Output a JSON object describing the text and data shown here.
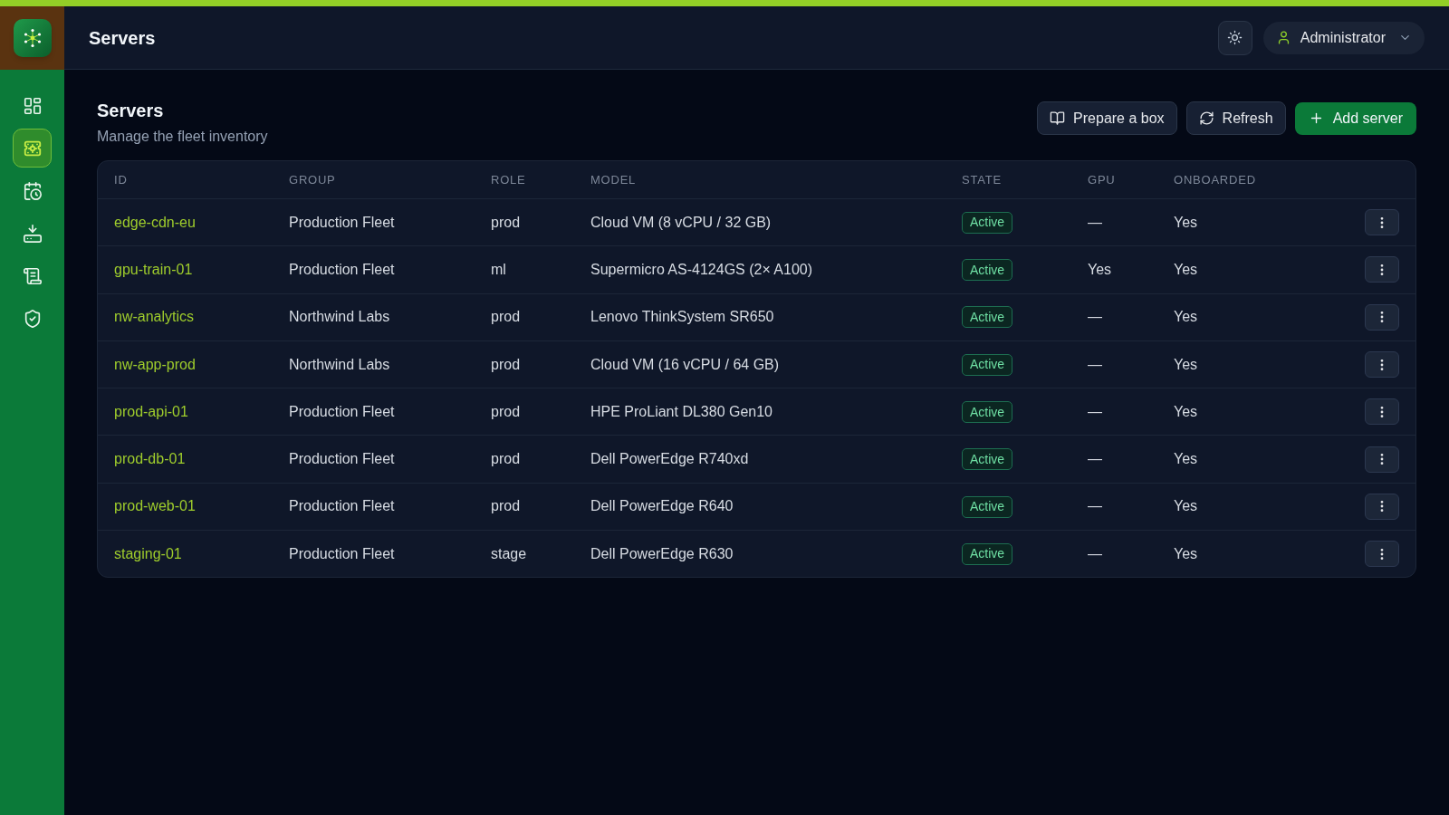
{
  "sidebar": {
    "items": [
      {
        "selected": false
      },
      {
        "selected": true
      },
      {
        "selected": false
      },
      {
        "selected": false
      },
      {
        "selected": false
      },
      {
        "selected": false
      }
    ]
  },
  "header": {
    "title": "Servers",
    "user": {
      "name": "Administrator"
    }
  },
  "page": {
    "title": "Servers",
    "subtitle": "Manage the fleet inventory",
    "actions": [
      {
        "label": "Prepare a box",
        "kind": "secondary"
      },
      {
        "label": "Refresh",
        "kind": "secondary"
      },
      {
        "label": "Add server",
        "kind": "primary"
      }
    ]
  },
  "table": {
    "columns": [
      "ID",
      "GROUP",
      "ROLE",
      "MODEL",
      "STATE",
      "GPU",
      "ONBOARDED"
    ],
    "rows": [
      {
        "id": "edge-cdn-eu",
        "group": "Production Fleet",
        "role": "prod",
        "model": "Cloud VM (8 vCPU / 32 GB)",
        "state": "Active",
        "gpu": "—",
        "onboarded": "Yes"
      },
      {
        "id": "gpu-train-01",
        "group": "Production Fleet",
        "role": "ml",
        "model": "Supermicro AS-4124GS (2× A100)",
        "state": "Active",
        "gpu": "Yes",
        "onboarded": "Yes"
      },
      {
        "id": "nw-analytics",
        "group": "Northwind Labs",
        "role": "prod",
        "model": "Lenovo ThinkSystem SR650",
        "state": "Active",
        "gpu": "—",
        "onboarded": "Yes"
      },
      {
        "id": "nw-app-prod",
        "group": "Northwind Labs",
        "role": "prod",
        "model": "Cloud VM (16 vCPU / 64 GB)",
        "state": "Active",
        "gpu": "—",
        "onboarded": "Yes"
      },
      {
        "id": "prod-api-01",
        "group": "Production Fleet",
        "role": "prod",
        "model": "HPE ProLiant DL380 Gen10",
        "state": "Active",
        "gpu": "—",
        "onboarded": "Yes"
      },
      {
        "id": "prod-db-01",
        "group": "Production Fleet",
        "role": "prod",
        "model": "Dell PowerEdge R740xd",
        "state": "Active",
        "gpu": "—",
        "onboarded": "Yes"
      },
      {
        "id": "prod-web-01",
        "group": "Production Fleet",
        "role": "prod",
        "model": "Dell PowerEdge R640",
        "state": "Active",
        "gpu": "—",
        "onboarded": "Yes"
      },
      {
        "id": "staging-01",
        "group": "Production Fleet",
        "role": "stage",
        "model": "Dell PowerEdge R630",
        "state": "Active",
        "gpu": "—",
        "onboarded": "Yes"
      }
    ]
  }
}
